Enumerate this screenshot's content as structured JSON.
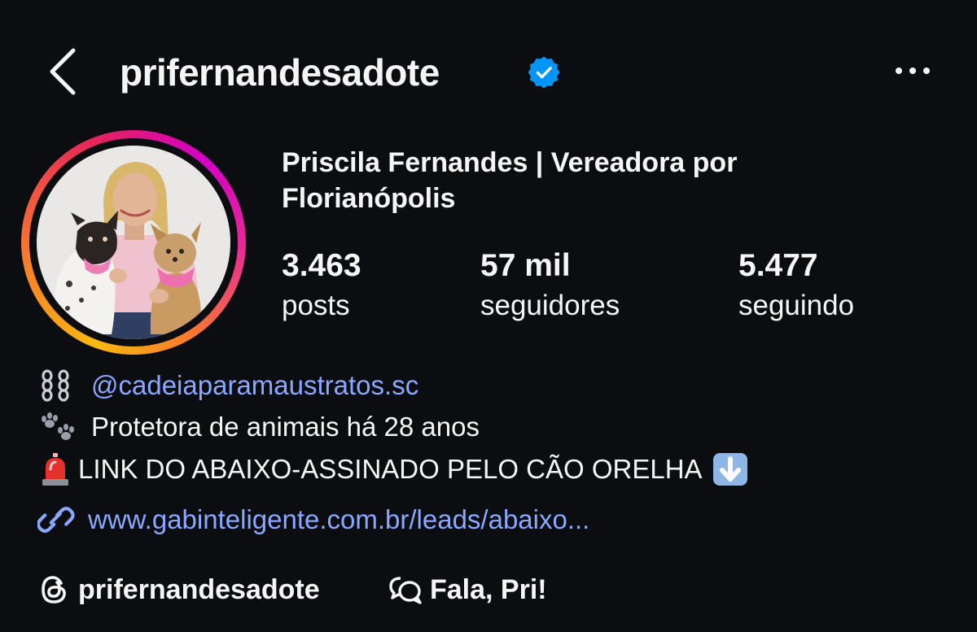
{
  "header": {
    "username": "prifernandesadote",
    "verified": true,
    "back_icon": "chevron-left-icon",
    "more_icon": "more-horizontal-icon"
  },
  "profile": {
    "full_name": "Priscila Fernandes | Vereadora por Florianópolis",
    "avatar_ring_colors": [
      "#f9b90f",
      "#e4245c",
      "#d300c5"
    ]
  },
  "stats": [
    {
      "value": "3.463",
      "label": "posts"
    },
    {
      "value": "57 mil",
      "label": "seguidores"
    },
    {
      "value": "5.477",
      "label": "seguindo"
    }
  ],
  "bio": {
    "line1_icon": "chains-emoji",
    "line1_mention": "@cadeiaparamaustratos.sc",
    "line2_icon": "paw-prints-emoji",
    "line2_text": "Protetora de animais há 28 anos",
    "line3_icon": "rotating-light-emoji",
    "line3_text": "LINK DO ABAIXO-ASSINADO PELO CÃO ORELHA",
    "line3_trailing_icon": "down-arrow-emoji",
    "link_icon": "link-icon",
    "link_text": "www.gabinteligente.com.br/leads/abaixo..."
  },
  "footer": {
    "threads_icon": "threads-icon",
    "threads_label": "prifernandesadote",
    "chat_icon": "chat-bubbles-icon",
    "chat_label": "Fala, Pri!"
  },
  "colors": {
    "background": "#0b0d11",
    "text": "#f5f5f5",
    "link": "#8aa8ff",
    "verified": "#0095f6"
  }
}
